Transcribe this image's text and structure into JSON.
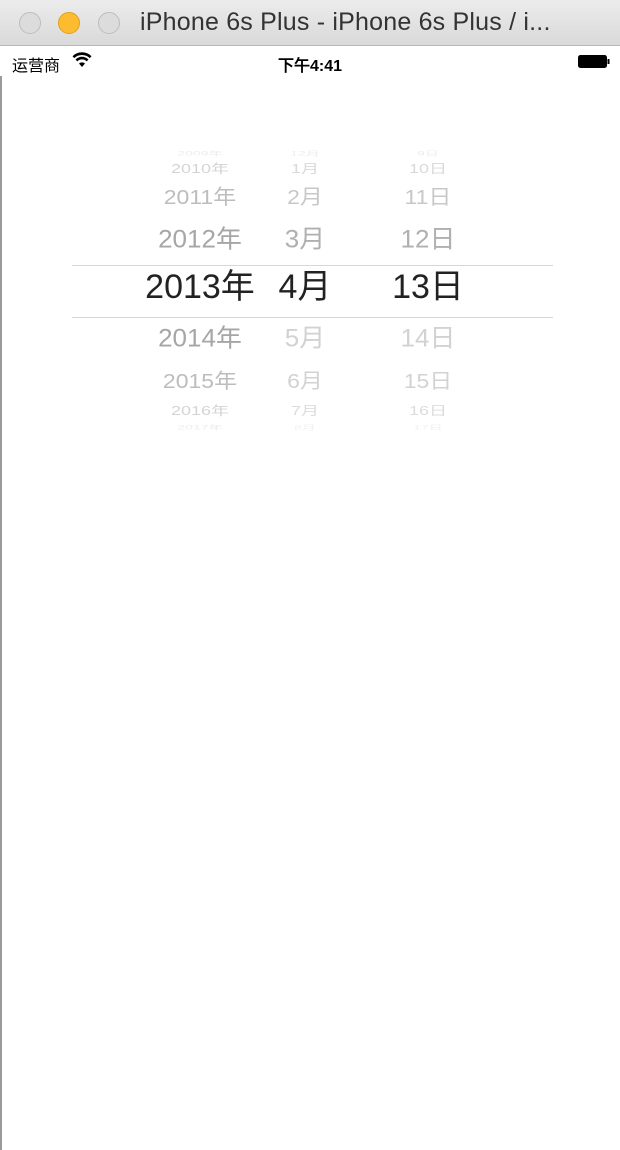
{
  "window": {
    "title": "iPhone 6s Plus - iPhone 6s Plus / i..."
  },
  "status_bar": {
    "carrier": "运营商",
    "time": "下午4:41",
    "icons": [
      "wifi-icon",
      "battery-icon"
    ]
  },
  "picker": {
    "years": [
      "2009年",
      "2010年",
      "2011年",
      "2012年",
      "2013年",
      "2014年",
      "2015年",
      "2016年",
      "2017年"
    ],
    "months": [
      "12月",
      "1月",
      "2月",
      "3月",
      "4月",
      "5月",
      "6月",
      "7月",
      "8月"
    ],
    "days": [
      "9日",
      "10日",
      "11日",
      "12日",
      "13日",
      "14日",
      "15日",
      "16日",
      "17日"
    ],
    "selected": {
      "year": "2013年",
      "month": "4月",
      "day": "13日"
    }
  }
}
